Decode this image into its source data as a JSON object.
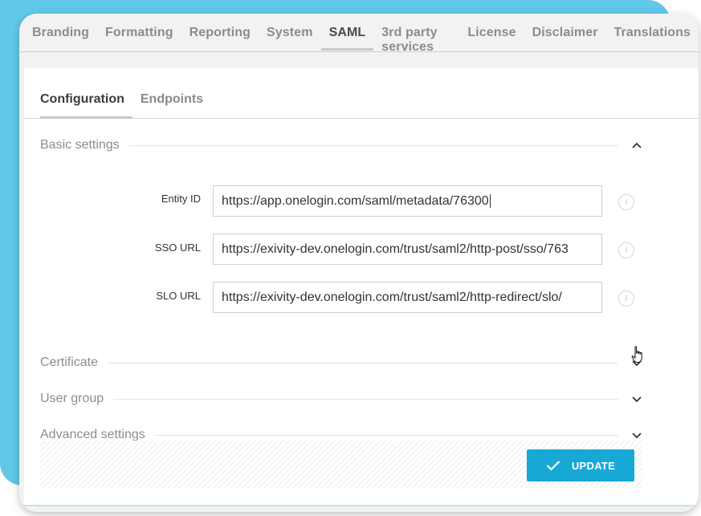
{
  "top_tabs": [
    {
      "label": "Branding"
    },
    {
      "label": "Formatting"
    },
    {
      "label": "Reporting"
    },
    {
      "label": "System"
    },
    {
      "label": "SAML",
      "active": true
    },
    {
      "label": "3rd party services"
    },
    {
      "label": "License"
    },
    {
      "label": "Disclaimer"
    },
    {
      "label": "Translations"
    }
  ],
  "sub_tabs": [
    {
      "label": "Configuration",
      "active": true
    },
    {
      "label": "Endpoints"
    }
  ],
  "sections": {
    "basic": {
      "title": "Basic settings",
      "expanded": true
    },
    "certificate": {
      "title": "Certificate",
      "expanded": false
    },
    "user_group": {
      "title": "User group",
      "expanded": false
    },
    "advanced": {
      "title": "Advanced settings",
      "expanded": false
    }
  },
  "fields": {
    "entity_id": {
      "label": "Entity ID",
      "value": "https://app.onelogin.com/saml/metadata/76300"
    },
    "sso_url": {
      "label": "SSO URL",
      "value": "https://exivity-dev.onelogin.com/trust/saml2/http-post/sso/763"
    },
    "slo_url": {
      "label": "SLO URL",
      "value": "https://exivity-dev.onelogin.com/trust/saml2/http-redirect/slo/"
    }
  },
  "icons": {
    "info": "info-icon",
    "chevron_up": "chevron-up-icon",
    "chevron_down": "chevron-down-icon",
    "check": "check-icon",
    "cursor": "hand-pointer-icon"
  },
  "actions": {
    "update_label": "UPDATE"
  },
  "colors": {
    "accent": "#17a8d6",
    "backdrop": "#62c8e9"
  }
}
